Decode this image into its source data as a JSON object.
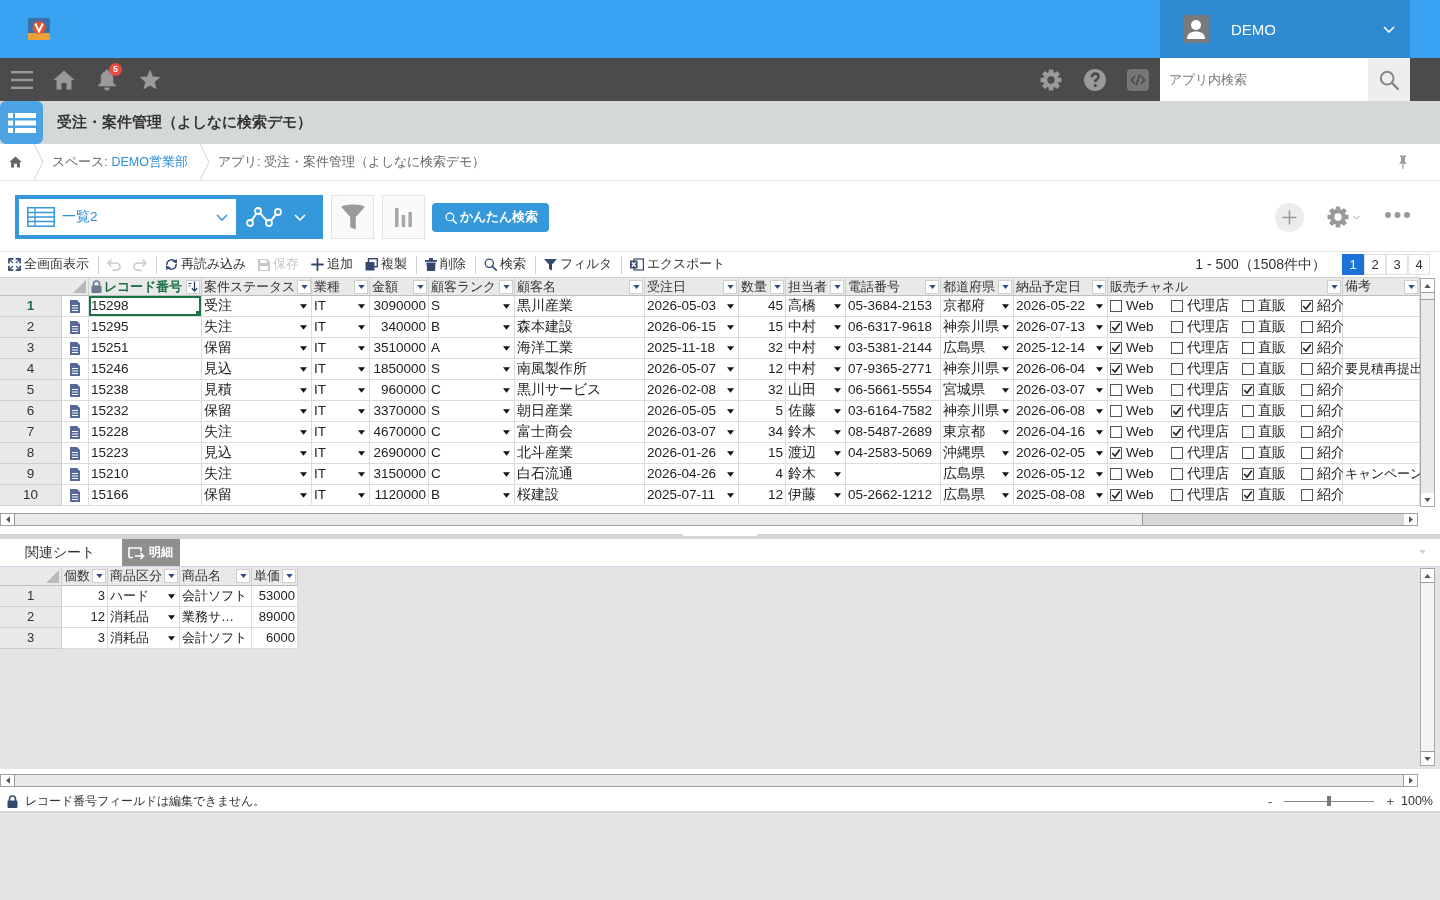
{
  "top_bar": {
    "user_name": "DEMO"
  },
  "nav_bar": {
    "notification_count": "5",
    "search": {
      "placeholder": "アプリ内検索"
    }
  },
  "app_header": {
    "title": "受注・案件管理（よしなに検索デモ）"
  },
  "breadcrumb": {
    "space_label": "スペース:",
    "space_link": "DEMO営業部",
    "app_path": "アプリ: 受注・案件管理（よしなに検索デモ）"
  },
  "view_bar": {
    "view_name": "一覧2",
    "quick_search_button": "かんたん検索"
  },
  "sheet_toolbar": {
    "groups": [
      [
        {
          "kind": "fullscreen",
          "label": "全画面表示",
          "disabled": false
        }
      ],
      [
        {
          "kind": "undo",
          "disabled": true
        },
        {
          "kind": "redo",
          "disabled": true
        }
      ],
      [
        {
          "kind": "reload",
          "label": "再読み込み",
          "disabled": false
        },
        {
          "kind": "save",
          "label": "保存",
          "disabled": true
        },
        {
          "kind": "add",
          "label": "追加",
          "disabled": false
        },
        {
          "kind": "duplicate",
          "label": "複製",
          "disabled": false
        }
      ],
      [
        {
          "kind": "delete",
          "label": "削除",
          "disabled": false
        }
      ],
      [
        {
          "kind": "search",
          "label": "検索",
          "disabled": false
        }
      ],
      [
        {
          "kind": "filter",
          "label": "フィルタ",
          "disabled": false
        }
      ],
      [
        {
          "kind": "export",
          "label": "エクスポート",
          "disabled": false
        }
      ]
    ]
  },
  "pagination": {
    "range": "1 - 500（1508件中）",
    "pages": [
      {
        "label": "1",
        "selected": true
      },
      {
        "label": "2",
        "selected": false
      },
      {
        "label": "3",
        "selected": false
      },
      {
        "label": "4",
        "selected": false
      }
    ]
  },
  "table": {
    "columns": [
      {
        "label": "レコード番号",
        "kind": "text",
        "locked": true,
        "sorted": true,
        "selected": true
      },
      {
        "label": "案件ステータス",
        "kind": "dropdown",
        "locked": false,
        "sorted": false,
        "selected": false
      },
      {
        "label": "業種",
        "kind": "dropdown",
        "locked": false,
        "sorted": false,
        "selected": false
      },
      {
        "label": "金額",
        "kind": "number",
        "locked": false,
        "sorted": false,
        "selected": false
      },
      {
        "label": "顧客ランク",
        "kind": "dropdown",
        "locked": false,
        "sorted": false,
        "selected": false
      },
      {
        "label": "顧客名",
        "kind": "text",
        "locked": false,
        "sorted": false,
        "selected": false
      },
      {
        "label": "受注日",
        "kind": "dropdown",
        "locked": false,
        "sorted": false,
        "selected": false
      },
      {
        "label": "数量",
        "kind": "number",
        "locked": false,
        "sorted": false,
        "selected": false
      },
      {
        "label": "担当者",
        "kind": "dropdown",
        "locked": false,
        "sorted": false,
        "selected": false
      },
      {
        "label": "電話番号",
        "kind": "text",
        "locked": false,
        "sorted": false,
        "selected": false
      },
      {
        "label": "都道府県",
        "kind": "dropdown",
        "locked": false,
        "sorted": false,
        "selected": false
      },
      {
        "label": "納品予定日",
        "kind": "dropdown",
        "locked": false,
        "sorted": false,
        "selected": false
      },
      {
        "label": "販売チャネル",
        "kind": "checkboxes",
        "locked": false,
        "sorted": false,
        "selected": false
      },
      {
        "label": "備考",
        "kind": "text",
        "locked": false,
        "sorted": false,
        "selected": false
      }
    ],
    "rows": [
      {
        "number": "1",
        "selected": true,
        "cells": [
          "15298",
          "受注",
          "IT",
          "3090000",
          "S",
          "黒川産業",
          "2026-05-03",
          "45",
          "高橋",
          "05-3684-2153",
          "京都府",
          "2026-05-22",
          {
            "options": [
              {
                "label": "Web",
                "checked": false
              },
              {
                "label": "代理店",
                "checked": false
              },
              {
                "label": "直販",
                "checked": false
              },
              {
                "label": "紹介",
                "checked": true
              }
            ]
          },
          null
        ]
      },
      {
        "number": "2",
        "selected": false,
        "cells": [
          "15295",
          "失注",
          "IT",
          "340000",
          "B",
          "森本建設",
          "2026-06-15",
          "15",
          "中村",
          "06-6317-9618",
          "神奈川県",
          "2026-07-13",
          {
            "options": [
              {
                "label": "Web",
                "checked": true
              },
              {
                "label": "代理店",
                "checked": false
              },
              {
                "label": "直販",
                "checked": false
              },
              {
                "label": "紹介",
                "checked": false
              }
            ]
          },
          null
        ]
      },
      {
        "number": "3",
        "selected": false,
        "cells": [
          "15251",
          "保留",
          "IT",
          "3510000",
          "A",
          "海洋工業",
          "2025-11-18",
          "32",
          "中村",
          "03-5381-2144",
          "広島県",
          "2025-12-14",
          {
            "options": [
              {
                "label": "Web",
                "checked": true
              },
              {
                "label": "代理店",
                "checked": false
              },
              {
                "label": "直販",
                "checked": false
              },
              {
                "label": "紹介",
                "checked": true
              }
            ]
          },
          null
        ]
      },
      {
        "number": "4",
        "selected": false,
        "cells": [
          "15246",
          "見込",
          "IT",
          "1850000",
          "S",
          "南風製作所",
          "2026-05-07",
          "12",
          "中村",
          "07-9365-2771",
          "神奈川県",
          "2026-06-04",
          {
            "options": [
              {
                "label": "Web",
                "checked": true
              },
              {
                "label": "代理店",
                "checked": false
              },
              {
                "label": "直販",
                "checked": false
              },
              {
                "label": "紹介",
                "checked": false
              }
            ]
          },
          "要見積再提出"
        ]
      },
      {
        "number": "5",
        "selected": false,
        "cells": [
          "15238",
          "見積",
          "IT",
          "960000",
          "C",
          "黒川サービス",
          "2026-02-08",
          "32",
          "山田",
          "06-5661-5554",
          "宮城県",
          "2026-03-07",
          {
            "options": [
              {
                "label": "Web",
                "checked": false
              },
              {
                "label": "代理店",
                "checked": false
              },
              {
                "label": "直販",
                "checked": true
              },
              {
                "label": "紹介",
                "checked": false
              }
            ]
          },
          null
        ]
      },
      {
        "number": "6",
        "selected": false,
        "cells": [
          "15232",
          "保留",
          "IT",
          "3370000",
          "S",
          "朝日産業",
          "2026-05-05",
          "5",
          "佐藤",
          "03-6164-7582",
          "神奈川県",
          "2026-06-08",
          {
            "options": [
              {
                "label": "Web",
                "checked": false
              },
              {
                "label": "代理店",
                "checked": true
              },
              {
                "label": "直販",
                "checked": false
              },
              {
                "label": "紹介",
                "checked": false
              }
            ]
          },
          null
        ]
      },
      {
        "number": "7",
        "selected": false,
        "cells": [
          "15228",
          "失注",
          "IT",
          "4670000",
          "C",
          "富士商会",
          "2026-03-07",
          "34",
          "鈴木",
          "08-5487-2689",
          "東京都",
          "2026-04-16",
          {
            "options": [
              {
                "label": "Web",
                "checked": false
              },
              {
                "label": "代理店",
                "checked": true
              },
              {
                "label": "直販",
                "checked": false
              },
              {
                "label": "紹介",
                "checked": false
              }
            ]
          },
          null
        ]
      },
      {
        "number": "8",
        "selected": false,
        "cells": [
          "15223",
          "見込",
          "IT",
          "2690000",
          "C",
          "北斗産業",
          "2026-01-26",
          "15",
          "渡辺",
          "04-2583-5069",
          "沖縄県",
          "2026-02-05",
          {
            "options": [
              {
                "label": "Web",
                "checked": true
              },
              {
                "label": "代理店",
                "checked": false
              },
              {
                "label": "直販",
                "checked": false
              },
              {
                "label": "紹介",
                "checked": false
              }
            ]
          },
          null
        ]
      },
      {
        "number": "9",
        "selected": false,
        "cells": [
          "15210",
          "失注",
          "IT",
          "3150000",
          "C",
          "白石流通",
          "2026-04-26",
          "4",
          "鈴木",
          null,
          "広島県",
          "2026-05-12",
          {
            "options": [
              {
                "label": "Web",
                "checked": false
              },
              {
                "label": "代理店",
                "checked": false
              },
              {
                "label": "直販",
                "checked": true
              },
              {
                "label": "紹介",
                "checked": false
              }
            ]
          },
          "キャンペーン"
        ]
      },
      {
        "number": "10",
        "selected": false,
        "cells": [
          "15166",
          "保留",
          "IT",
          "1120000",
          "B",
          "桜建設",
          "2025-07-11",
          "12",
          "伊藤",
          "05-2662-1212",
          "広島県",
          "2025-08-08",
          {
            "options": [
              {
                "label": "Web",
                "checked": true
              },
              {
                "label": "代理店",
                "checked": false
              },
              {
                "label": "直販",
                "checked": true
              },
              {
                "label": "紹介",
                "checked": false
              }
            ]
          },
          null
        ]
      }
    ]
  },
  "related_sheet": {
    "label": "関連シート",
    "tabs": [
      {
        "label": "明細",
        "selected": true
      }
    ],
    "table": {
      "columns": [
        {
          "label": "個数",
          "kind": "number"
        },
        {
          "label": "商品区分",
          "kind": "dropdown"
        },
        {
          "label": "商品名",
          "kind": "text"
        },
        {
          "label": "単価",
          "kind": "number"
        }
      ],
      "rows": [
        {
          "number": "1",
          "cells": [
            "3",
            "ハード",
            "会計ソフト",
            "53000"
          ]
        },
        {
          "number": "2",
          "cells": [
            "12",
            "消耗品",
            "業務サ…",
            "89000"
          ]
        },
        {
          "number": "3",
          "cells": [
            "3",
            "消耗品",
            "会計ソフト",
            "6000"
          ]
        }
      ]
    }
  },
  "status_bar": {
    "message": "レコード番号フィールドは編集できません。",
    "zoom": {
      "minus": "-",
      "plus": "+",
      "level": 0.5,
      "reading": "100%"
    }
  }
}
